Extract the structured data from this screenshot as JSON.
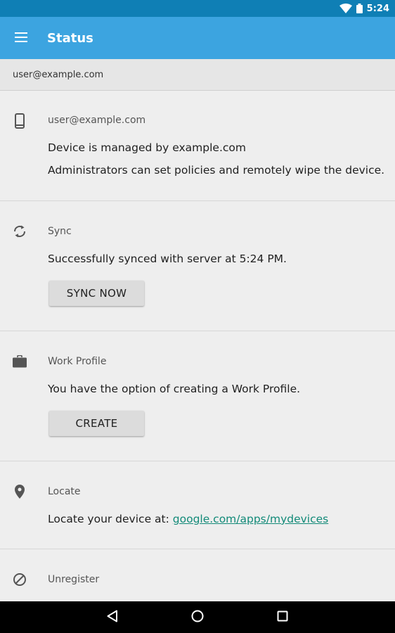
{
  "status_bar": {
    "time": "5:24"
  },
  "app_bar": {
    "title": "Status"
  },
  "account": {
    "email": "user@example.com"
  },
  "sections": {
    "device": {
      "title": "user@example.com",
      "line1": "Device is managed by example.com",
      "line2": "Administrators can set policies and remotely wipe the device."
    },
    "sync": {
      "title": "Sync",
      "text": "Successfully synced with server at 5:24 PM.",
      "button": "SYNC NOW"
    },
    "work_profile": {
      "title": "Work Profile",
      "text": "You have the option of creating a Work Profile.",
      "button": "CREATE"
    },
    "locate": {
      "title": "Locate",
      "text": "Locate your device at: ",
      "link": "google.com/apps/mydevices"
    },
    "unregister": {
      "title": "Unregister"
    }
  },
  "icons": {
    "menu": "menu-icon",
    "wifi": "wifi-icon",
    "battery": "battery-icon",
    "phone": "phone-icon",
    "sync": "sync-icon",
    "briefcase": "briefcase-icon",
    "location": "location-pin-icon",
    "block": "block-icon",
    "back": "back-icon",
    "home": "home-icon",
    "recents": "recents-icon"
  },
  "colors": {
    "status_bar": "#0f7fb5",
    "app_bar": "#3ca4e0",
    "link": "#128a78",
    "background": "#eeeeee"
  }
}
